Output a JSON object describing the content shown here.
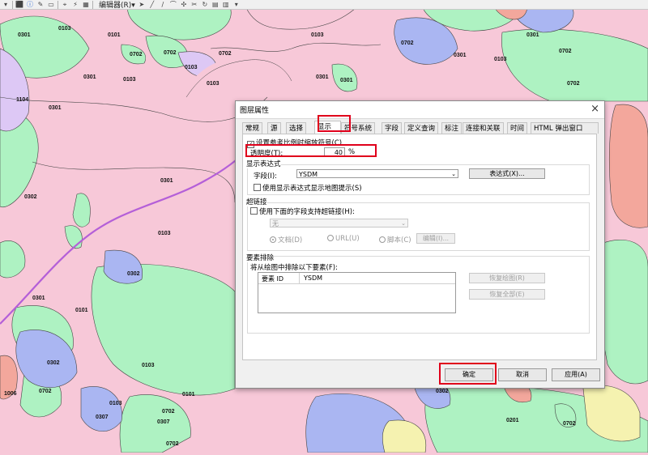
{
  "toolbar": {
    "editor_label": "编辑器(R)▾",
    "icons": [
      "dropdown-icon",
      "info-icon",
      "identify-icon",
      "html-popup-icon",
      "measure-icon",
      "find-icon",
      "hyperlink-icon",
      "edit-tool-icon",
      "select-arrow-icon"
    ]
  },
  "map": {
    "labels": [
      "0301",
      "0103",
      "0101",
      "0702",
      "0702",
      "0301",
      "0103",
      "0103",
      "0301",
      "0103",
      "1104",
      "0301",
      "0103",
      "0301",
      "0702",
      "0702",
      "0301",
      "0103",
      "0301",
      "0702",
      "0702",
      "0301",
      "0302",
      "0302",
      "0101",
      "0301",
      "0103",
      "0302",
      "0103",
      "0702",
      "0103",
      "0101",
      "1006",
      "0307",
      "0702",
      "0307",
      "0702",
      "0302",
      "0201",
      "0702"
    ],
    "colors": {
      "pink": "#f7c8d8",
      "green": "#aef2c2",
      "blue": "#aab6f2",
      "purple": "#ddc8f5",
      "salmon": "#f3a79c",
      "yellow": "#f5f2b0",
      "road": "#b45fd8"
    }
  },
  "dialog": {
    "title": "图层属性",
    "close_glyph": "×",
    "tabs": [
      "常规",
      "源",
      "选择",
      "显示",
      "符号系统",
      "字段",
      "定义查询",
      "标注",
      "连接和关联",
      "时间",
      "HTML 弹出窗口"
    ],
    "active_tab": "显示",
    "scale_symbols_label": "设置参考比例时缩放符号(C)",
    "transparency_label": "透明度(T):",
    "transparency_value": "40",
    "transparency_unit": "%",
    "display_expression": {
      "group_title": "显示表达式",
      "field_label": "字段(I):",
      "field_value": "YSDM",
      "expression_button": "表达式(X)...",
      "map_tips_label": "使用显示表达式显示地图提示(S)"
    },
    "hyperlinks": {
      "group_title": "超链接",
      "support_label": "使用下面的字段支持超链接(H):",
      "field_value": "无",
      "option_document": "文档(D)",
      "option_url": "URL(U)",
      "option_script": "脚本(C)",
      "edit_button": "编辑(I)..."
    },
    "feature_exclusion": {
      "group_title": "要素排除",
      "description": "将从绘图中排除以下要素(F):",
      "columns": [
        "要素 ID",
        "YSDM"
      ],
      "restore_drawing_button": "恢复绘图(R)",
      "restore_all_button": "恢复全部(E)"
    },
    "buttons": {
      "ok": "确定",
      "cancel": "取消",
      "apply": "应用(A)"
    }
  },
  "highlight_color": "#e0001b"
}
